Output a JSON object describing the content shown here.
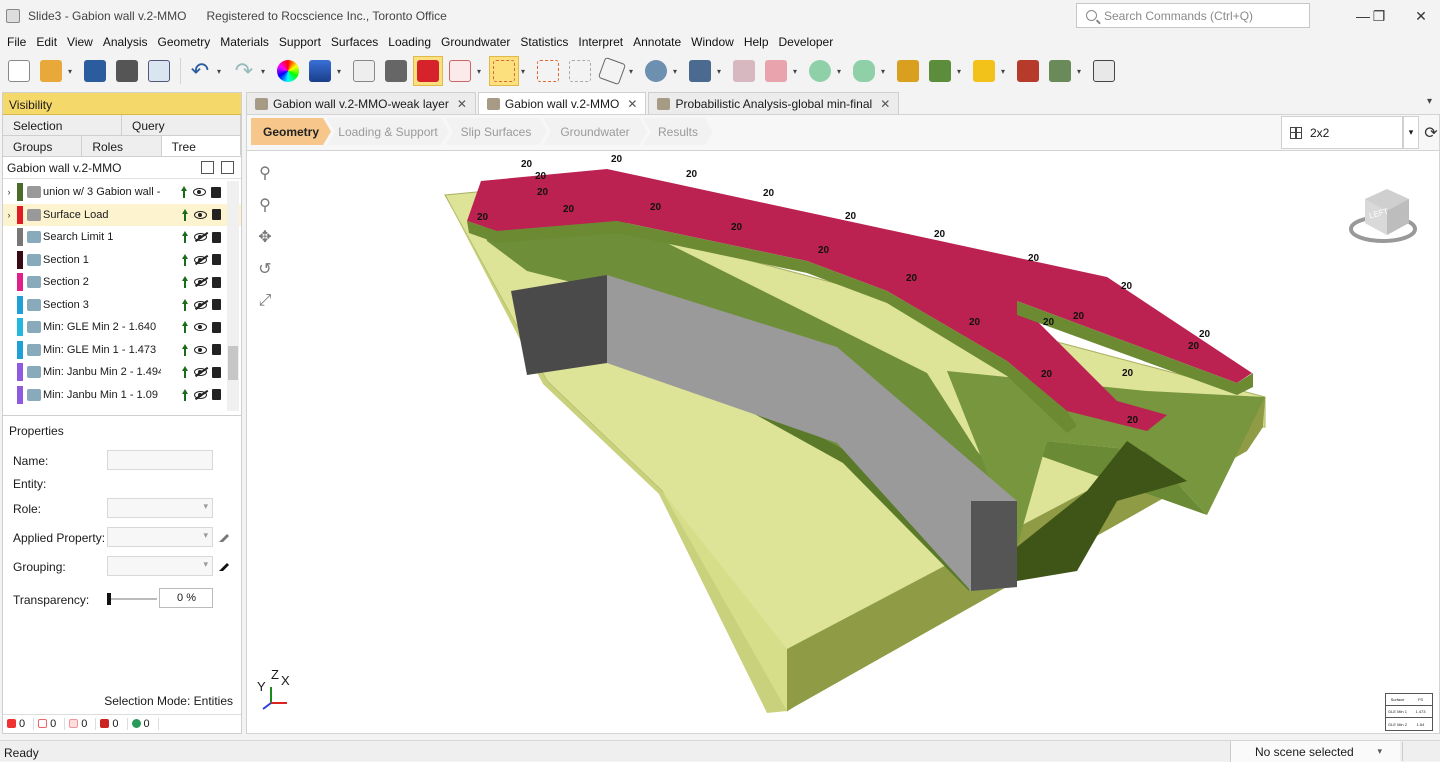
{
  "window": {
    "title": "Slide3 - Gabion wall v.2-MMO      Registered to Rocscience Inc., Toronto Office",
    "search_placeholder": "Search Commands (Ctrl+Q)"
  },
  "menu": [
    "File",
    "Edit",
    "View",
    "Analysis",
    "Geometry",
    "Materials",
    "Support",
    "Surfaces",
    "Loading",
    "Groundwater",
    "Statistics",
    "Interpret",
    "Annotate",
    "Window",
    "Help",
    "Developer"
  ],
  "left_panel": {
    "title": "Visibility",
    "tabs_row1": [
      "Selection",
      "Query"
    ],
    "tabs_row2": [
      "Groups",
      "Roles",
      "Tree"
    ],
    "tree_root": "Gabion wall v.2-MMO",
    "tree_items": [
      {
        "label": "union w/ 3 Gabion wall -",
        "color": "#4b6b2a",
        "visible": "eye",
        "locked": true,
        "expand": true
      },
      {
        "label": "Surface Load",
        "color": "#e01b24",
        "visible": "eye",
        "locked": false,
        "expand": true,
        "selected": true
      },
      {
        "label": "Search Limit 1",
        "color": "#777777",
        "visible": "eye-off",
        "locked": false,
        "expand": false
      },
      {
        "label": "Section 1",
        "color": "#3a0a14",
        "visible": "eye-off",
        "locked": false,
        "expand": false
      },
      {
        "label": "Section 2",
        "color": "#e0218a",
        "visible": "eye-off",
        "locked": false,
        "expand": false
      },
      {
        "label": "Section 3",
        "color": "#1fa0d8",
        "visible": "eye-off",
        "locked": false,
        "expand": false
      },
      {
        "label": "Min: GLE Min 2  -  1.640",
        "color": "#22b8e0",
        "visible": "eye",
        "locked": false,
        "expand": false
      },
      {
        "label": "Min: GLE Min 1  -  1.473",
        "color": "#1fa0d8",
        "visible": "eye",
        "locked": false,
        "expand": false
      },
      {
        "label": "Min: Janbu Min 2  -  1.494",
        "color": "#8d5ae0",
        "visible": "eye-off",
        "locked": false,
        "expand": false
      },
      {
        "label": "Min: Janbu Min 1  -  1.09",
        "color": "#8d5ae0",
        "visible": "eye-off",
        "locked": false,
        "expand": false
      }
    ]
  },
  "properties": {
    "title": "Properties",
    "name_label": "Name:",
    "entity_label": "Entity:",
    "role_label": "Role:",
    "applied_label": "Applied Property:",
    "grouping_label": "Grouping:",
    "transparency_label": "Transparency:",
    "transparency_value": "0 %",
    "selection_mode": "Selection Mode:  Entities",
    "counts": [
      "0",
      "0",
      "0",
      "0",
      "0"
    ]
  },
  "doc_tabs": [
    {
      "label": "Gabion wall v.2-MMO-weak layer",
      "active": false
    },
    {
      "label": "Gabion wall v.2-MMO",
      "active": true
    },
    {
      "label": "Probabilistic Analysis-global min-final",
      "active": false
    }
  ],
  "workflow": [
    "Geometry",
    "Loading & Support",
    "Slip Surfaces",
    "Groundwater",
    "Results"
  ],
  "layout_select": "2x2",
  "viewport": {
    "load_value": "20",
    "cube_face": "LEFT",
    "axis_labels": [
      "Y",
      "Z",
      "X"
    ],
    "legend": {
      "header": [
        "Surface",
        "FS"
      ],
      "rows": [
        [
          "GLE Min 1",
          "1.473"
        ],
        [
          "GLE Min 2",
          "1.64"
        ]
      ]
    }
  },
  "status": {
    "ready": "Ready",
    "scene": "No scene selected"
  }
}
